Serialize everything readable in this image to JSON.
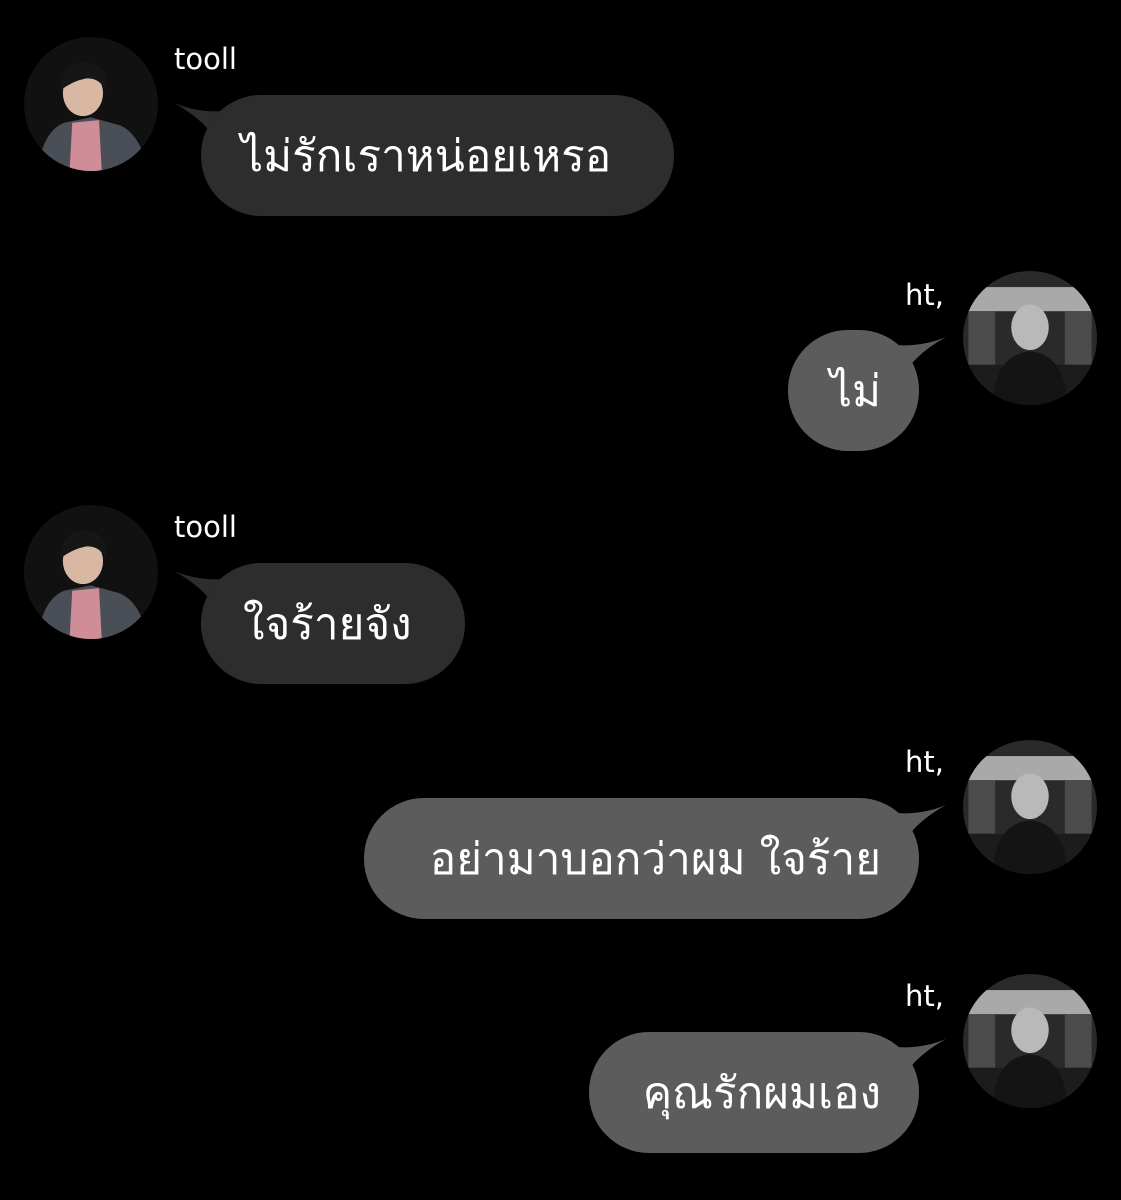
{
  "colors": {
    "background": "#000000",
    "incoming_bubble": "#2d2d2d",
    "outgoing_bubble": "#5c5c5c",
    "text": "#ffffff"
  },
  "messages": [
    {
      "sender": "tooll",
      "side": "left",
      "text": "ไม่รักเราหน่อยเหรอ",
      "avatar": "pink-shirt-boy-avatar"
    },
    {
      "sender": "ht,",
      "side": "right",
      "text": "ไม่",
      "avatar": "grey-hair-boy-avatar"
    },
    {
      "sender": "tooll",
      "side": "left",
      "text": "ใจร้ายจัง",
      "avatar": "pink-shirt-boy-avatar"
    },
    {
      "sender": "ht,",
      "side": "right",
      "text": "อย่ามาบอกว่าผม ใจร้าย",
      "avatar": "grey-hair-boy-avatar"
    },
    {
      "sender": "ht,",
      "side": "right",
      "text": "คุณรักผมเอง",
      "avatar": "grey-hair-boy-avatar"
    }
  ]
}
